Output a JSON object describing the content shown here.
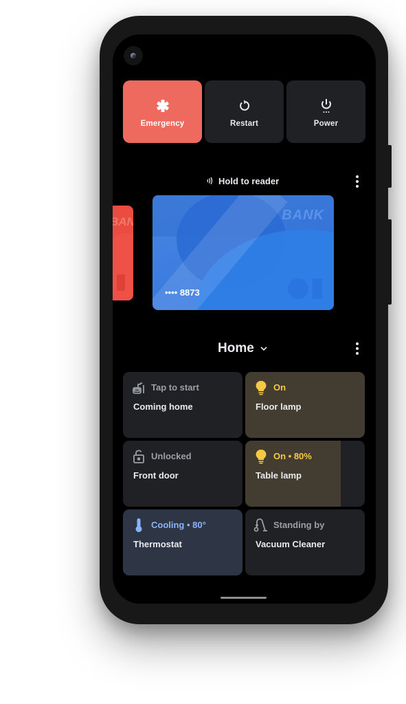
{
  "power_menu": {
    "buttons": [
      {
        "id": "emergency",
        "label": "Emergency",
        "icon": "emergency-asterisk-icon",
        "color": "#ef6a5e"
      },
      {
        "id": "restart",
        "label": "Restart",
        "icon": "restart-icon"
      },
      {
        "id": "power",
        "label": "Power",
        "icon": "power-icon"
      }
    ]
  },
  "wallet": {
    "header": "Hold to reader",
    "header_icon": "nfc-icon",
    "cards": [
      {
        "bank": "BANK",
        "color": "#ea4c3f",
        "state": "partially-visible"
      },
      {
        "bank": "BANK",
        "number": "•••• 8873",
        "color": "#3a7be0",
        "state": "selected"
      }
    ]
  },
  "home": {
    "title": "Home",
    "tiles": [
      {
        "name": "Coming home",
        "status": "Tap to start",
        "icon": "routine-icon",
        "state": "inactive"
      },
      {
        "name": "Floor lamp",
        "status": "On",
        "icon": "lightbulb-icon",
        "state": "on",
        "accent": "#f6c844"
      },
      {
        "name": "Front door",
        "status": "Unlocked",
        "icon": "unlocked-icon",
        "state": "inactive"
      },
      {
        "name": "Table lamp",
        "status": "On • 80%",
        "icon": "lightbulb-icon",
        "state": "on",
        "brightness": 0.8,
        "accent": "#f6c844"
      },
      {
        "name": "Thermostat",
        "status": "Cooling • 80°",
        "icon": "thermometer-icon",
        "state": "cooling",
        "accent": "#8ab4f8"
      },
      {
        "name": "Vacuum Cleaner",
        "status": "Standing by",
        "icon": "vacuum-icon",
        "state": "inactive"
      }
    ]
  }
}
